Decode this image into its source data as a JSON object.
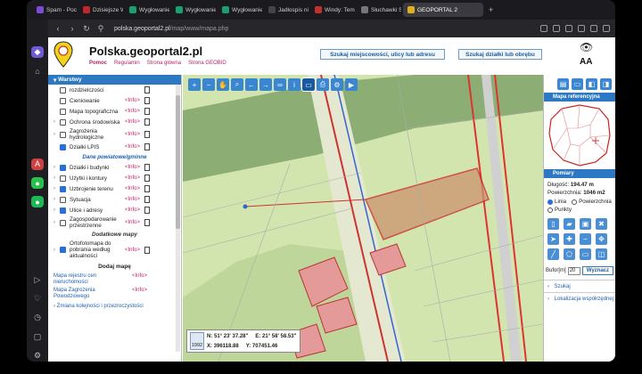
{
  "tabs": [
    {
      "label": "Spam - Poczta",
      "color": "#7b4bd8"
    },
    {
      "label": "Dzisiejsze Wyd",
      "color": "#c0262e"
    },
    {
      "label": "Wygłowanie",
      "color": "#1aa070"
    },
    {
      "label": "Wygłowanie",
      "color": "#1aa070"
    },
    {
      "label": "Wygłowanie",
      "color": "#1aa070"
    },
    {
      "label": "Jadłospis niez",
      "color": "#444"
    },
    {
      "label": "Windy: Temper",
      "color": "#c43030"
    },
    {
      "label": "Słuchawki Suw",
      "color": "#777"
    },
    {
      "label": "GEOPORTAL 2",
      "color": "#e0b020",
      "active": true
    }
  ],
  "address": {
    "host": "polska.geoportal2.pl",
    "path": "/map/www/mapa.php"
  },
  "header": {
    "title": "Polska.geoportal2.pl",
    "links": [
      "Pomoc",
      "Regulamin",
      "Strona główna",
      "Strona GEOBID"
    ],
    "search_place": "Szukaj miejscowości, ulicy lub adresu",
    "search_parcel": "Szukaj działki lub obrębu",
    "font_size_label": "AA"
  },
  "left": {
    "title": "Warstwy",
    "layers_top": [
      {
        "name": "rozdzielczości",
        "info": "",
        "checked": false,
        "arrow": false
      },
      {
        "name": "Cieniowanie",
        "info": "<Info>",
        "checked": false,
        "arrow": false
      },
      {
        "name": "Mapa topograficzna",
        "info": "<Info>",
        "checked": false,
        "arrow": false
      },
      {
        "name": "Ochrona środowiska",
        "info": "<Info>",
        "checked": false,
        "arrow": true
      },
      {
        "name": "Zagrożenia hydrologiczne",
        "info": "<Info>",
        "checked": false,
        "arrow": true
      },
      {
        "name": "Działki LPIS",
        "info": "<Info>",
        "checked": true,
        "arrow": false
      }
    ],
    "group1": "Dane powiatowe/gminne",
    "layers_mid": [
      {
        "name": "Działki i budynki",
        "info": "<Info>",
        "checked": true,
        "arrow": true
      },
      {
        "name": "Użytki i kontury",
        "info": "<Info>",
        "checked": false,
        "arrow": true
      },
      {
        "name": "Uzbrojenie terenu",
        "info": "<Info>",
        "checked": true,
        "arrow": true
      },
      {
        "name": "Sytuacja",
        "info": "<Info>",
        "checked": false,
        "arrow": true
      },
      {
        "name": "Ulice i adresy",
        "info": "<Info>",
        "checked": true,
        "arrow": true
      },
      {
        "name": "Zagospodarowanie przestrzenne",
        "info": "<Info>",
        "checked": false,
        "arrow": true
      }
    ],
    "group2": "Dodatkowe mapy",
    "layers_bottom": [
      {
        "name": "Ortofotomapa do pobrania według aktualności",
        "info": "<Info>",
        "checked": true,
        "arrow": true
      }
    ],
    "add_map": "Dodaj mapę",
    "maps": [
      {
        "name": "Mapa rejestru cen nieruchomości",
        "info": "<Info>"
      },
      {
        "name": "Mapa Zagrożenia Powodziowego",
        "info": "<Info>"
      }
    ],
    "change_order": "Zmiana kolejności i przezroczystości"
  },
  "map": {
    "coords": {
      "n": "N: 51° 23' 37.28\"",
      "e": "E: 21° 58' 58.53\"",
      "x": "X: 396118.88",
      "y": "Y: 707451.46"
    },
    "year": "1992"
  },
  "right": {
    "ref_title": "Mapa referencyjna",
    "measure_title": "Pomiary",
    "length_label": "Długość:",
    "length_value": "194.47 m",
    "area_label": "Powierzchnia:",
    "area_value": "1046 m2",
    "mode_line": "Linia",
    "mode_area": "Powierzchnia",
    "mode_points": "Punkty",
    "buffer_label": "Bufor[m]",
    "buffer_value": "20",
    "show_button": "Wyznacz",
    "search": "Szukaj",
    "locate": "Lokalizacja współrzędnej"
  }
}
